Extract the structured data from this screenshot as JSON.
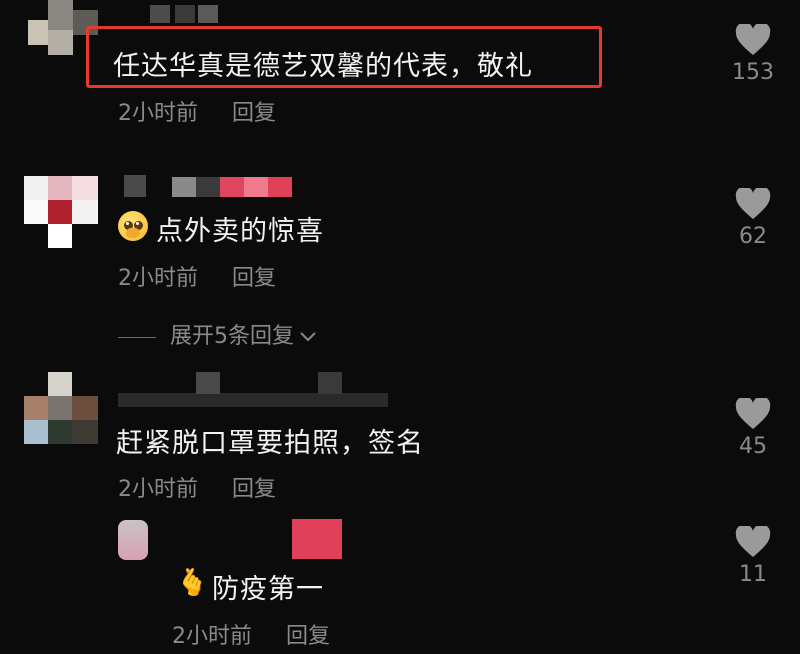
{
  "comments": [
    {
      "text": "任达华真是德艺双馨的代表，敬礼",
      "time": "2小时前",
      "reply": "回复",
      "likes": "153"
    },
    {
      "text": "点外卖的惊喜",
      "time": "2小时前",
      "reply": "回复",
      "likes": "62",
      "emoji": "pleading-face-icon",
      "expand": "展开5条回复"
    },
    {
      "text": "赶紧脱口罩要拍照，签名",
      "time": "2小时前",
      "reply": "回复",
      "likes": "45"
    },
    {
      "text": "防疫第一",
      "time": "2小时前",
      "reply": "回复",
      "likes": "11",
      "emoji": "finger-heart-icon"
    }
  ],
  "colors": {
    "background": "#0b0b0b",
    "highlight": "#e8372b",
    "meta": "#8a8a8a",
    "heart": "#9a9a9a"
  }
}
